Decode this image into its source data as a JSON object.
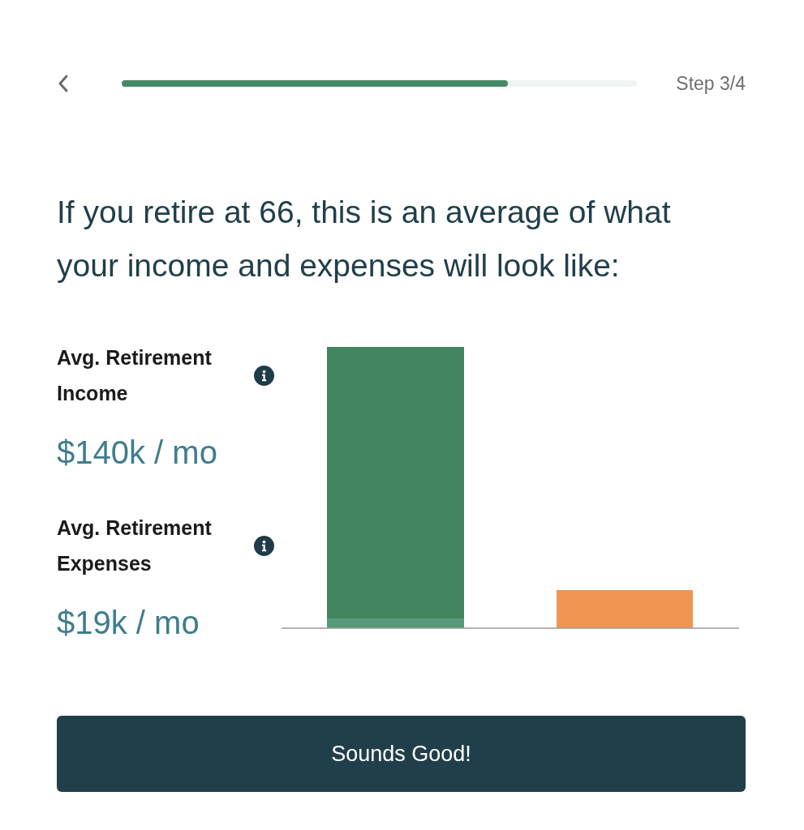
{
  "header": {
    "step_label": "Step 3/4",
    "progress": {
      "level": 0.75
    }
  },
  "heading": "If you retire at 66, this is an average of what your income and expenses will look like:",
  "metrics": [
    {
      "label": "Avg. Retirement Income",
      "value": "$140k / mo"
    },
    {
      "label": "Avg. Retirement Expenses",
      "value": "$19k / mo"
    }
  ],
  "button": {
    "label": "Sounds Good!"
  }
}
